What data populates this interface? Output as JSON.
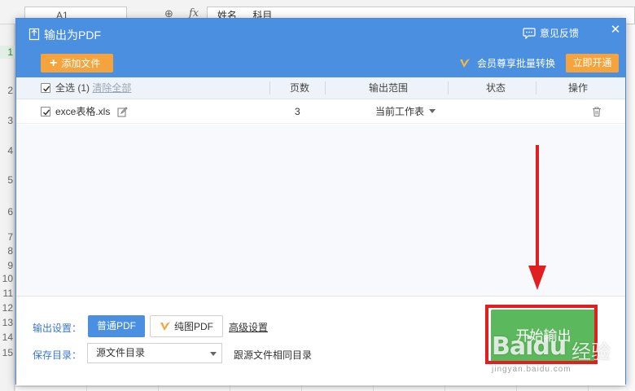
{
  "spreadsheet": {
    "cell_ref": "A1",
    "formula_text": "姓名 科目",
    "row_numbers": [
      "1",
      "2",
      "3",
      "4",
      "5",
      "6",
      "7",
      "8",
      "9",
      "10",
      "11",
      "12",
      "13",
      "14",
      "15"
    ]
  },
  "dialog": {
    "title": "输出为PDF",
    "feedback_label": "意见反馈",
    "close_glyph": "✕",
    "add_file_label": "添加文件",
    "vip_promo": "会员尊享批量转换",
    "open_now_label": "立即开通",
    "table": {
      "select_all_label": "全选",
      "select_count": "(1)",
      "clear_all_label": "清除全部",
      "columns": {
        "pages": "页数",
        "range": "输出范围",
        "status": "状态",
        "actions": "操作"
      },
      "rows": [
        {
          "filename": "exce表格.xls",
          "pages": "3",
          "range": "当前工作表",
          "status": ""
        }
      ]
    },
    "footer": {
      "output_settings_label": "输出设置：",
      "normal_pdf_label": "普通PDF",
      "image_pdf_label": "纯图PDF",
      "advanced_settings_label": "高级设置",
      "save_dir_label": "保存目录：",
      "save_dir_value": "源文件目录",
      "same_dir_text": "跟源文件相同目录",
      "start_button_label": "开始输出"
    }
  },
  "watermark": {
    "brand": "Baidu",
    "text": "经验",
    "url": "jingyan.baidu.com"
  },
  "colors": {
    "header_blue": "#4a8fe0",
    "accent_orange": "#f5a33c",
    "start_green": "#5cb85c",
    "annotation_red": "#e02020"
  },
  "icons": [
    "pdf-export-icon",
    "feedback-icon",
    "close-icon",
    "plus-icon",
    "vip-icon",
    "checkbox-checked-icon",
    "edit-icon",
    "dropdown-caret-icon",
    "trash-icon",
    "vip-small-icon",
    "search-icon",
    "fx-icon"
  ]
}
